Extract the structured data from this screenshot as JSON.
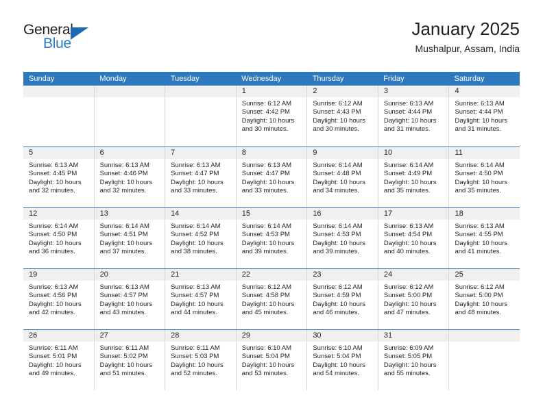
{
  "brand": {
    "logo_text_top": "General",
    "logo_text_bottom": "Blue",
    "logo_triangle_color": "#1d68b3",
    "logo_blue_color": "#2b7cc4"
  },
  "header": {
    "title": "January 2025",
    "subtitle": "Mushalpur, Assam, India"
  },
  "theme": {
    "header_bg": "#2e79bd",
    "header_text": "#ffffff",
    "daynum_band_bg": "#f0f0f0",
    "row_divider": "#2e79bd",
    "col_divider": "#d7d7d7",
    "body_text": "#231f20"
  },
  "weekdays": [
    "Sunday",
    "Monday",
    "Tuesday",
    "Wednesday",
    "Thursday",
    "Friday",
    "Saturday"
  ],
  "weeks": [
    [
      {
        "day": "",
        "lines": []
      },
      {
        "day": "",
        "lines": []
      },
      {
        "day": "",
        "lines": []
      },
      {
        "day": "1",
        "lines": [
          "Sunrise: 6:12 AM",
          "Sunset: 4:42 PM",
          "Daylight: 10 hours",
          "and 30 minutes."
        ]
      },
      {
        "day": "2",
        "lines": [
          "Sunrise: 6:12 AM",
          "Sunset: 4:43 PM",
          "Daylight: 10 hours",
          "and 30 minutes."
        ]
      },
      {
        "day": "3",
        "lines": [
          "Sunrise: 6:13 AM",
          "Sunset: 4:44 PM",
          "Daylight: 10 hours",
          "and 31 minutes."
        ]
      },
      {
        "day": "4",
        "lines": [
          "Sunrise: 6:13 AM",
          "Sunset: 4:44 PM",
          "Daylight: 10 hours",
          "and 31 minutes."
        ]
      }
    ],
    [
      {
        "day": "5",
        "lines": [
          "Sunrise: 6:13 AM",
          "Sunset: 4:45 PM",
          "Daylight: 10 hours",
          "and 32 minutes."
        ]
      },
      {
        "day": "6",
        "lines": [
          "Sunrise: 6:13 AM",
          "Sunset: 4:46 PM",
          "Daylight: 10 hours",
          "and 32 minutes."
        ]
      },
      {
        "day": "7",
        "lines": [
          "Sunrise: 6:13 AM",
          "Sunset: 4:47 PM",
          "Daylight: 10 hours",
          "and 33 minutes."
        ]
      },
      {
        "day": "8",
        "lines": [
          "Sunrise: 6:13 AM",
          "Sunset: 4:47 PM",
          "Daylight: 10 hours",
          "and 33 minutes."
        ]
      },
      {
        "day": "9",
        "lines": [
          "Sunrise: 6:14 AM",
          "Sunset: 4:48 PM",
          "Daylight: 10 hours",
          "and 34 minutes."
        ]
      },
      {
        "day": "10",
        "lines": [
          "Sunrise: 6:14 AM",
          "Sunset: 4:49 PM",
          "Daylight: 10 hours",
          "and 35 minutes."
        ]
      },
      {
        "day": "11",
        "lines": [
          "Sunrise: 6:14 AM",
          "Sunset: 4:50 PM",
          "Daylight: 10 hours",
          "and 35 minutes."
        ]
      }
    ],
    [
      {
        "day": "12",
        "lines": [
          "Sunrise: 6:14 AM",
          "Sunset: 4:50 PM",
          "Daylight: 10 hours",
          "and 36 minutes."
        ]
      },
      {
        "day": "13",
        "lines": [
          "Sunrise: 6:14 AM",
          "Sunset: 4:51 PM",
          "Daylight: 10 hours",
          "and 37 minutes."
        ]
      },
      {
        "day": "14",
        "lines": [
          "Sunrise: 6:14 AM",
          "Sunset: 4:52 PM",
          "Daylight: 10 hours",
          "and 38 minutes."
        ]
      },
      {
        "day": "15",
        "lines": [
          "Sunrise: 6:14 AM",
          "Sunset: 4:53 PM",
          "Daylight: 10 hours",
          "and 39 minutes."
        ]
      },
      {
        "day": "16",
        "lines": [
          "Sunrise: 6:14 AM",
          "Sunset: 4:53 PM",
          "Daylight: 10 hours",
          "and 39 minutes."
        ]
      },
      {
        "day": "17",
        "lines": [
          "Sunrise: 6:13 AM",
          "Sunset: 4:54 PM",
          "Daylight: 10 hours",
          "and 40 minutes."
        ]
      },
      {
        "day": "18",
        "lines": [
          "Sunrise: 6:13 AM",
          "Sunset: 4:55 PM",
          "Daylight: 10 hours",
          "and 41 minutes."
        ]
      }
    ],
    [
      {
        "day": "19",
        "lines": [
          "Sunrise: 6:13 AM",
          "Sunset: 4:56 PM",
          "Daylight: 10 hours",
          "and 42 minutes."
        ]
      },
      {
        "day": "20",
        "lines": [
          "Sunrise: 6:13 AM",
          "Sunset: 4:57 PM",
          "Daylight: 10 hours",
          "and 43 minutes."
        ]
      },
      {
        "day": "21",
        "lines": [
          "Sunrise: 6:13 AM",
          "Sunset: 4:57 PM",
          "Daylight: 10 hours",
          "and 44 minutes."
        ]
      },
      {
        "day": "22",
        "lines": [
          "Sunrise: 6:12 AM",
          "Sunset: 4:58 PM",
          "Daylight: 10 hours",
          "and 45 minutes."
        ]
      },
      {
        "day": "23",
        "lines": [
          "Sunrise: 6:12 AM",
          "Sunset: 4:59 PM",
          "Daylight: 10 hours",
          "and 46 minutes."
        ]
      },
      {
        "day": "24",
        "lines": [
          "Sunrise: 6:12 AM",
          "Sunset: 5:00 PM",
          "Daylight: 10 hours",
          "and 47 minutes."
        ]
      },
      {
        "day": "25",
        "lines": [
          "Sunrise: 6:12 AM",
          "Sunset: 5:00 PM",
          "Daylight: 10 hours",
          "and 48 minutes."
        ]
      }
    ],
    [
      {
        "day": "26",
        "lines": [
          "Sunrise: 6:11 AM",
          "Sunset: 5:01 PM",
          "Daylight: 10 hours",
          "and 49 minutes."
        ]
      },
      {
        "day": "27",
        "lines": [
          "Sunrise: 6:11 AM",
          "Sunset: 5:02 PM",
          "Daylight: 10 hours",
          "and 51 minutes."
        ]
      },
      {
        "day": "28",
        "lines": [
          "Sunrise: 6:11 AM",
          "Sunset: 5:03 PM",
          "Daylight: 10 hours",
          "and 52 minutes."
        ]
      },
      {
        "day": "29",
        "lines": [
          "Sunrise: 6:10 AM",
          "Sunset: 5:04 PM",
          "Daylight: 10 hours",
          "and 53 minutes."
        ]
      },
      {
        "day": "30",
        "lines": [
          "Sunrise: 6:10 AM",
          "Sunset: 5:04 PM",
          "Daylight: 10 hours",
          "and 54 minutes."
        ]
      },
      {
        "day": "31",
        "lines": [
          "Sunrise: 6:09 AM",
          "Sunset: 5:05 PM",
          "Daylight: 10 hours",
          "and 55 minutes."
        ]
      },
      {
        "day": "",
        "lines": []
      }
    ]
  ]
}
